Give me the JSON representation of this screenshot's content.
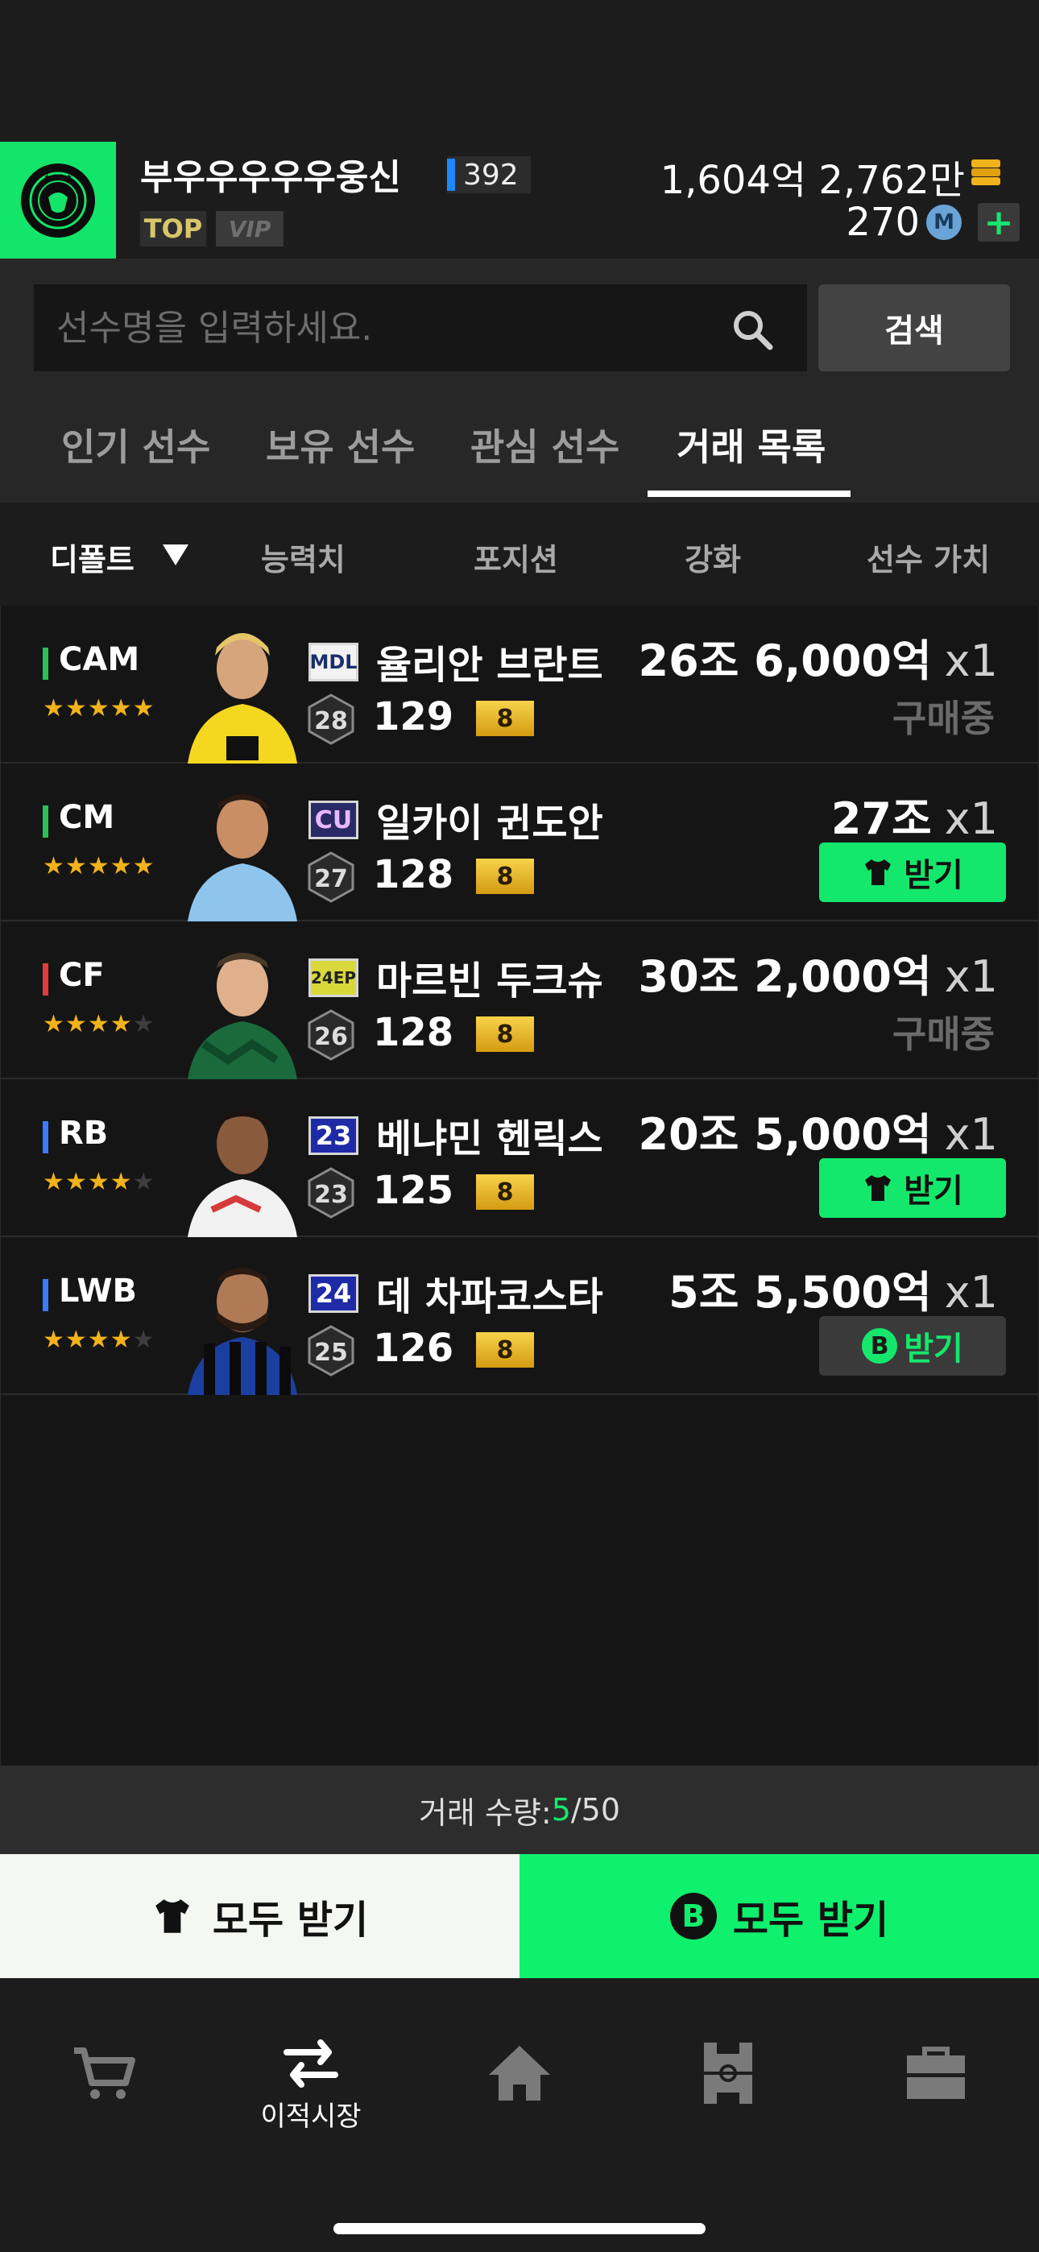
{
  "profile": {
    "username": "부우우우우우웅신",
    "level": "392",
    "tag_top": "TOP",
    "tag_vip": "VIP",
    "gold": "1,604억 2,762만",
    "mcoin": "270",
    "mcoin_icon_letter": "M",
    "plus": "+"
  },
  "search": {
    "placeholder": "선수명을 입력하세요.",
    "button": "검색"
  },
  "tabs": [
    {
      "label": "인기 선수"
    },
    {
      "label": "보유 선수"
    },
    {
      "label": "관심 선수"
    },
    {
      "label": "거래 목록"
    }
  ],
  "active_tab": "거래 목록",
  "sort": {
    "default": "디폴트",
    "ability": "능력치",
    "position": "포지션",
    "enhance": "강화",
    "value": "선수 가치"
  },
  "players": [
    {
      "position": "CAM",
      "pos_color": "#2bbf55",
      "stars": 5,
      "season": "MDL",
      "name": "율리안 브란트",
      "hex": "28",
      "ovr": "129",
      "grade": "8",
      "price": "26조 6,000억",
      "qty": "x1",
      "status": "구매중",
      "action": null
    },
    {
      "position": "CM",
      "pos_color": "#2bbf55",
      "stars": 5,
      "season": "CU",
      "name": "일카이 귄도안",
      "hex": "27",
      "ovr": "128",
      "grade": "8",
      "price": "27조",
      "qty": "x1",
      "status": null,
      "action": "받기"
    },
    {
      "position": "CF",
      "pos_color": "#e23b3b",
      "stars": 4,
      "season": "24EP",
      "name": "마르빈 두크슈",
      "hex": "26",
      "ovr": "128",
      "grade": "8",
      "price": "30조 2,000억",
      "qty": "x1",
      "status": "구매중",
      "action": null
    },
    {
      "position": "RB",
      "pos_color": "#3d7bff",
      "stars": 4,
      "season": "23",
      "name": "베냐민 헨릭스",
      "hex": "23",
      "ovr": "125",
      "grade": "8",
      "price": "20조 5,000억",
      "qty": "x1",
      "status": null,
      "action": "받기"
    },
    {
      "position": "LWB",
      "pos_color": "#3d7bff",
      "stars": 4,
      "season": "24",
      "name": "데 차파코스타",
      "hex": "25",
      "ovr": "126",
      "grade": "8",
      "price": "5조 5,500억",
      "qty": "x1",
      "status": null,
      "action": "받기"
    }
  ],
  "trade": {
    "label": "거래 수량: ",
    "current": "5",
    "total": "/50"
  },
  "bottom_buttons": {
    "all_receive_shirt": "모두 받기",
    "all_receive_b": "모두 받기",
    "b_letter": "B"
  },
  "nav": {
    "transfer_label": "이적시장"
  },
  "icons": {
    "cart": "cart-icon",
    "transfer": "transfer-arrows-icon",
    "home": "home-icon",
    "formation": "formation-icon",
    "locker": "locker-icon",
    "search": "search-icon",
    "shirt": "shirt-icon"
  },
  "colors": {
    "accent_green": "#14e86c",
    "gold": "#f2b21c"
  }
}
